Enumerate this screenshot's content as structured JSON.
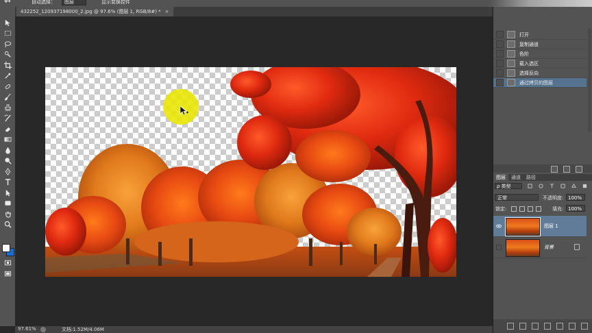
{
  "options_bar": {
    "auto_select_label": "自动选择：",
    "auto_select_value": "图层",
    "transform_controls_label": "显示变换控件"
  },
  "document_tab": {
    "title": "432252_120937198000_2.jpg @ 97.6% (图层 1, RGB/8#) *",
    "close": "×"
  },
  "tools": [
    "move-icon",
    "marquee-icon",
    "lasso-icon",
    "quick-select-icon",
    "crop-icon",
    "eyedropper-icon",
    "healing-icon",
    "brush-icon",
    "stamp-icon",
    "history-brush-icon",
    "eraser-icon",
    "gradient-icon",
    "blur-icon",
    "dodge-icon",
    "pen-icon",
    "type-icon",
    "path-select-icon",
    "shape-icon",
    "hand-icon",
    "zoom-icon"
  ],
  "colors": {
    "foreground": "#ffffff",
    "background": "#1a6fd6",
    "ui_dark": "#282828",
    "panel": "#535353",
    "highlight": "#55728f",
    "cursor_halo": "#e9e60a"
  },
  "history": {
    "items": [
      {
        "label": "打开",
        "active": false
      },
      {
        "label": "复制通道",
        "active": false
      },
      {
        "label": "色阶",
        "active": false
      },
      {
        "label": "载入选区",
        "active": false
      },
      {
        "label": "选择反向",
        "active": false
      },
      {
        "label": "通过拷贝的图层",
        "active": true
      }
    ]
  },
  "layers_panel": {
    "tabs": [
      "图层",
      "通道",
      "路径"
    ],
    "filter_kind": "ρ 类型",
    "blend_mode": "正常",
    "opacity_label": "不透明度:",
    "opacity_value": "100%",
    "lock_label": "锁定:",
    "fill_label": "填充:",
    "fill_value": "100%",
    "layers": [
      {
        "name": "图层 1",
        "visible": true,
        "selected": true,
        "locked": false
      },
      {
        "name": "背景",
        "visible": false,
        "selected": false,
        "locked": true
      }
    ]
  },
  "status_bar": {
    "zoom": "97.61%",
    "doc_info": "文档:1.52M/4.06M"
  }
}
